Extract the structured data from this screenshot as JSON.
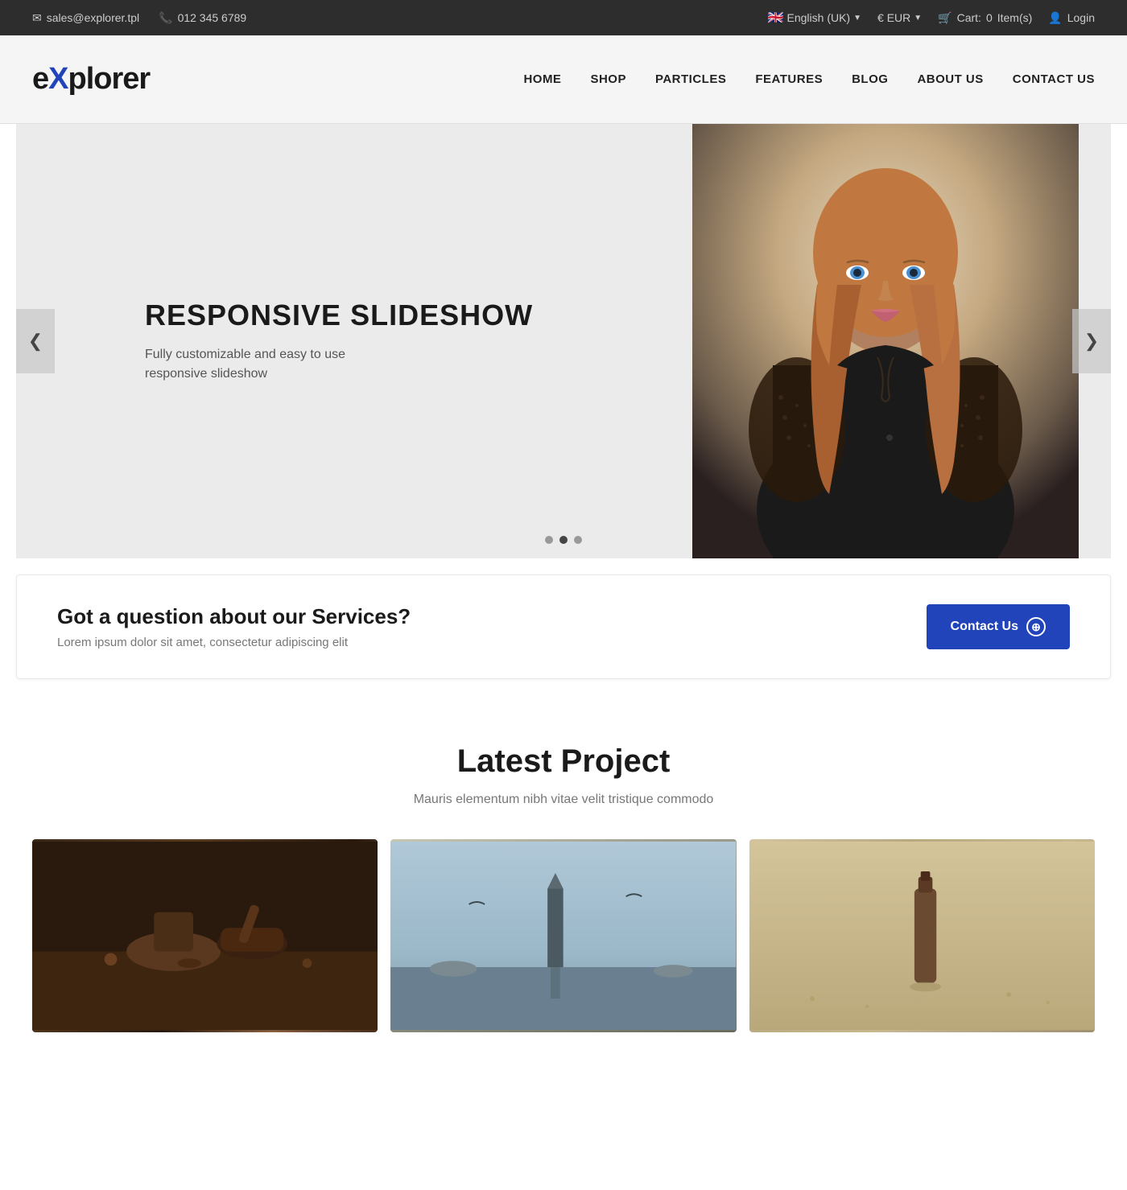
{
  "topbar": {
    "email": "sales@explorer.tpl",
    "phone": "012 345 6789",
    "language": "English (UK)",
    "currency": "€ EUR",
    "cart_label": "Cart:",
    "cart_count": "0",
    "cart_unit": "Item(s)",
    "login_label": "Login"
  },
  "header": {
    "logo_e": "e",
    "logo_x": "X",
    "logo_rest": "plorer",
    "nav": [
      {
        "label": "HOME",
        "id": "nav-home"
      },
      {
        "label": "SHOP",
        "id": "nav-shop"
      },
      {
        "label": "PARTICLES",
        "id": "nav-particles"
      },
      {
        "label": "FEATURES",
        "id": "nav-features"
      },
      {
        "label": "BLOG",
        "id": "nav-blog"
      },
      {
        "label": "ABOUT US",
        "id": "nav-about"
      },
      {
        "label": "CONTACT US",
        "id": "nav-contact"
      }
    ]
  },
  "slideshow": {
    "title": "RESPONSIVE SLIDESHOW",
    "description_line1": "Fully customizable and easy to use",
    "description_line2": "responsive slideshow",
    "prev_label": "❮",
    "next_label": "❯"
  },
  "cta": {
    "title": "Got a question about our Services?",
    "subtitle": "Lorem ipsum dolor sit amet, consectetur adipiscing elit",
    "button_label": "Contact Us"
  },
  "latest": {
    "title": "Latest Project",
    "subtitle": "Mauris elementum nibh vitae velit tristique commodo"
  }
}
